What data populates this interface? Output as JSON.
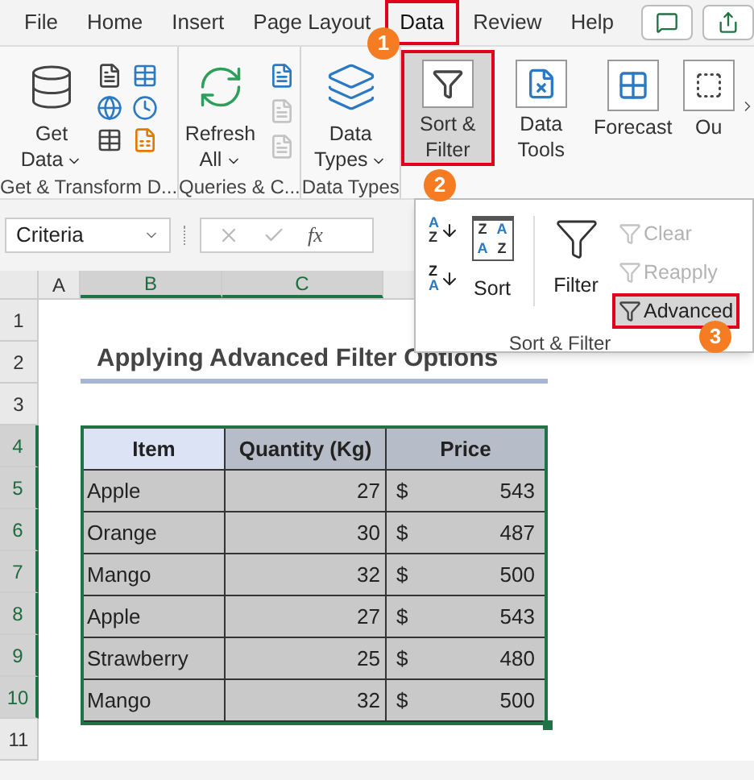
{
  "menu_tabs": [
    {
      "label": "File",
      "selected": false,
      "outlined": false
    },
    {
      "label": "Home",
      "selected": false,
      "outlined": false
    },
    {
      "label": "Insert",
      "selected": false,
      "outlined": false
    },
    {
      "label": "Page Layout",
      "selected": false,
      "outlined": false
    },
    {
      "label": "Data",
      "selected": true,
      "outlined": true
    },
    {
      "label": "Review",
      "selected": false,
      "outlined": false
    },
    {
      "label": "Help",
      "selected": false,
      "outlined": false
    }
  ],
  "ribbon": {
    "get_transform": {
      "button": [
        "Get",
        "Data"
      ],
      "label": "Get & Transform D..."
    },
    "queries": {
      "button": [
        "Refresh",
        "All"
      ],
      "small_tools": [
        {
          "disabled": false
        },
        {
          "disabled": true
        },
        {
          "disabled": true
        }
      ],
      "label": "Queries & C..."
    },
    "data_types": {
      "button": [
        "Data",
        "Types"
      ],
      "label": "Data Types"
    },
    "buttons": [
      {
        "kind": "sort_filter",
        "lines": [
          "Sort &",
          "Filter"
        ],
        "selected": true,
        "outlined": true
      },
      {
        "kind": "data_tools",
        "lines": [
          "Data",
          "Tools"
        ],
        "selected": false,
        "outlined": false
      },
      {
        "kind": "forecast",
        "lines": [
          "Forecast"
        ],
        "selected": false,
        "outlined": false
      },
      {
        "kind": "outline",
        "lines": [
          "Ou"
        ],
        "selected": false,
        "outlined": false
      }
    ]
  },
  "name_box": {
    "value": "Criteria"
  },
  "formula_bar": {
    "function_label": "fx"
  },
  "dropdown": {
    "sort_ascending": [
      "A",
      "Z"
    ],
    "sort_descending": [
      "Z",
      "A"
    ],
    "sort_icon": [
      "Z",
      "A",
      "A",
      "Z"
    ],
    "sort_label": "Sort",
    "filter_label": "Filter",
    "items": [
      {
        "label": "Clear",
        "disabled": true,
        "selected": false,
        "outlined": false
      },
      {
        "label": "Reapply",
        "disabled": true,
        "selected": false,
        "outlined": false
      },
      {
        "label": "Advanced",
        "disabled": false,
        "selected": true,
        "outlined": true
      }
    ],
    "group_label": "Sort & Filter"
  },
  "steps": [
    {
      "number": "1"
    },
    {
      "number": "2"
    },
    {
      "number": "3"
    }
  ],
  "sheet": {
    "columns": [
      {
        "label": "A",
        "selected": false
      },
      {
        "label": "B",
        "selected": true
      },
      {
        "label": "C",
        "selected": true
      }
    ],
    "rows": [
      {
        "label": "1",
        "selected": false
      },
      {
        "label": "2",
        "selected": false
      },
      {
        "label": "3",
        "selected": false
      },
      {
        "label": "4",
        "selected": true
      },
      {
        "label": "5",
        "selected": true
      },
      {
        "label": "6",
        "selected": true
      },
      {
        "label": "7",
        "selected": true
      },
      {
        "label": "8",
        "selected": true
      },
      {
        "label": "9",
        "selected": true
      },
      {
        "label": "10",
        "selected": true
      },
      {
        "label": "11",
        "selected": false
      }
    ],
    "title": "Applying Advanced Filter Options",
    "table": {
      "columns": [
        "Item",
        "Quantity (Kg)",
        "Price"
      ],
      "rows": [
        {
          "item": "Apple",
          "quantity": "27",
          "currency": "$",
          "price": "543"
        },
        {
          "item": "Orange",
          "quantity": "30",
          "currency": "$",
          "price": "487"
        },
        {
          "item": "Mango",
          "quantity": "32",
          "currency": "$",
          "price": "500"
        },
        {
          "item": "Apple",
          "quantity": "27",
          "currency": "$",
          "price": "543"
        },
        {
          "item": "Strawberry",
          "quantity": "25",
          "currency": "$",
          "price": "480"
        },
        {
          "item": "Mango",
          "quantity": "32",
          "currency": "$",
          "price": "500"
        }
      ]
    }
  }
}
